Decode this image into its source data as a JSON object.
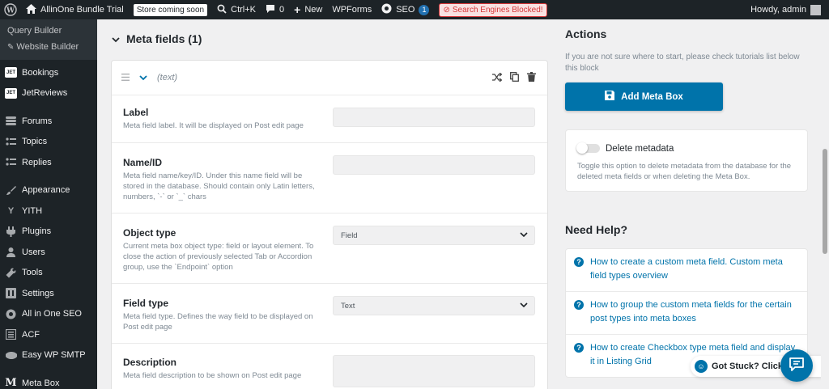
{
  "adminbar": {
    "site_name": "AllinOne Bundle Trial",
    "store_badge": "Store coming soon",
    "shortcut": "Ctrl+K",
    "comments_count": "0",
    "new_label": "New",
    "wpforms_label": "WPForms",
    "seo_label": "SEO",
    "seo_badge": "1",
    "search_engines_label": "Search Engines Blocked!",
    "howdy": "Howdy, admin"
  },
  "sidebar": {
    "sub_items": [
      {
        "label": "Query Builder"
      },
      {
        "label": "Website Builder"
      }
    ],
    "items": [
      {
        "label": "Bookings",
        "icon": "jet-icon"
      },
      {
        "label": "JetReviews",
        "icon": "jet-icon"
      },
      {
        "label": "Forums",
        "icon": "forums-icon"
      },
      {
        "label": "Topics",
        "icon": "topics-icon"
      },
      {
        "label": "Replies",
        "icon": "replies-icon"
      },
      {
        "label": "Appearance",
        "icon": "brush-icon"
      },
      {
        "label": "YITH",
        "icon": "yith-icon"
      },
      {
        "label": "Plugins",
        "icon": "plugin-icon"
      },
      {
        "label": "Users",
        "icon": "users-icon"
      },
      {
        "label": "Tools",
        "icon": "wrench-icon"
      },
      {
        "label": "Settings",
        "icon": "settings-icon"
      },
      {
        "label": "All in One SEO",
        "icon": "seo-icon"
      },
      {
        "label": "ACF",
        "icon": "acf-icon"
      },
      {
        "label": "Easy WP SMTP",
        "icon": "smtp-icon"
      },
      {
        "label": "Meta Box",
        "icon": "metabox-icon"
      }
    ]
  },
  "main": {
    "section_title": "Meta fields (1)",
    "field_card_title": "(text)",
    "rows": [
      {
        "label": "Label",
        "desc": "Meta field label. It will be displayed on Post edit page",
        "value": "",
        "type": "input"
      },
      {
        "label": "Name/ID",
        "desc": "Meta field name/key/ID. Under this name field will be stored in the database. Should contain only Latin letters, numbers, `-` or `_` chars",
        "value": "",
        "type": "input"
      },
      {
        "label": "Object type",
        "desc": "Current meta box object type: field or layout element. To close the action of previously selected Tab or Accordion group, use the `Endpoint` option",
        "value": "Field",
        "type": "select"
      },
      {
        "label": "Field type",
        "desc": "Meta field type. Defines the way field to be displayed on Post edit page",
        "value": "Text",
        "type": "select"
      },
      {
        "label": "Description",
        "desc": "Meta field description to be shown on Post edit page",
        "value": "",
        "type": "textarea"
      }
    ]
  },
  "actions": {
    "title": "Actions",
    "hint": "If you are not sure where to start, please check tutorials list below this block",
    "add_button": "Add Meta Box",
    "delete_label": "Delete metadata",
    "delete_desc": "Toggle this option to delete metadata from the database for the deleted meta fields or when deleting the Meta Box.",
    "delete_enabled": false
  },
  "help": {
    "title": "Need Help?",
    "links": [
      {
        "label": "How to create a custom meta field. Custom meta field types overview"
      },
      {
        "label": "How to group the custom meta fields for the certain post types into meta boxes"
      },
      {
        "label": "How to create Checkbox type meta field and display it in Listing Grid"
      }
    ],
    "stuck_label": "Got Stuck? Click"
  },
  "colors": {
    "accent": "#0073aa",
    "adminbar_bg": "#1d2327",
    "page_bg": "#f0f0f1"
  }
}
